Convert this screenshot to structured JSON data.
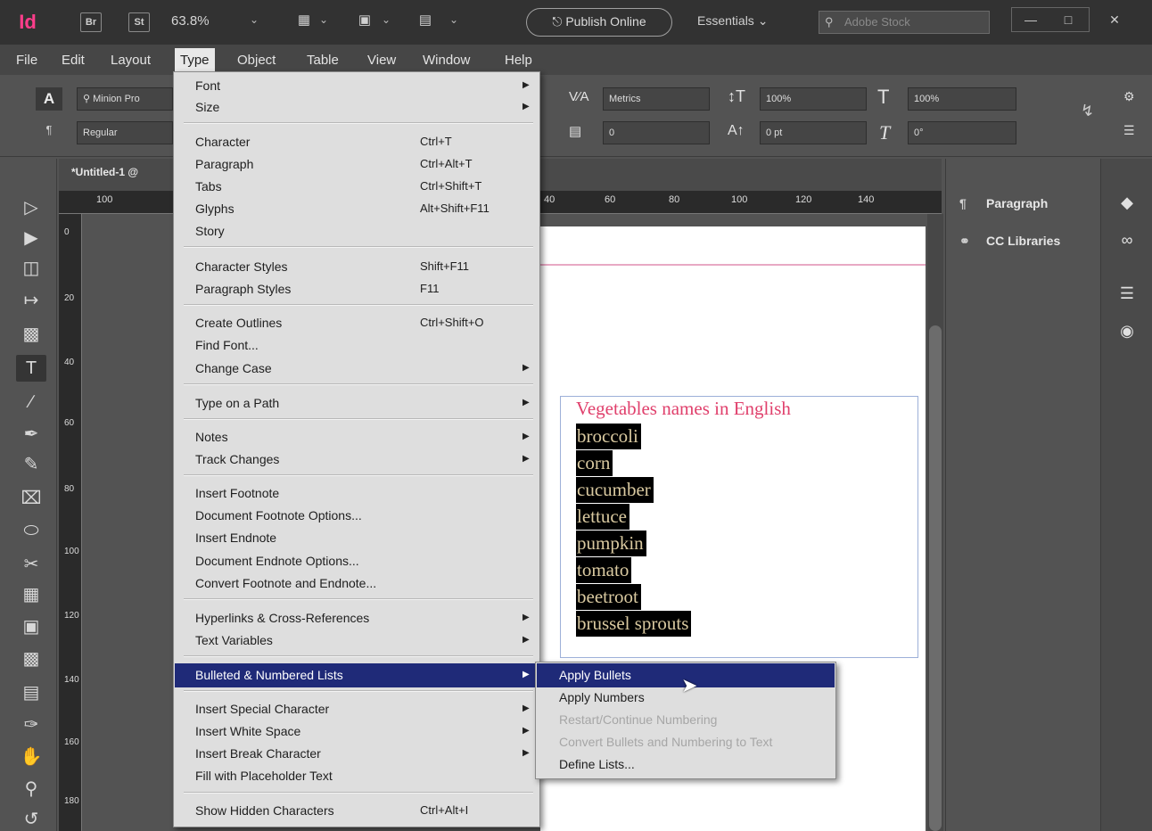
{
  "colors": {
    "brand": "#ff3d8b",
    "menu_highlight": "#1f2a78",
    "heading_text": "#e0406c",
    "highlighted_text_fg": "#d9c9a0"
  },
  "titlebar": {
    "app_logo": "Id",
    "bridge_btn": "Br",
    "stock_btn": "St",
    "zoom": "63.8%",
    "publish_online": "Publish Online",
    "workspace": "Essentials",
    "search_placeholder": "Adobe Stock"
  },
  "menubar": [
    "File",
    "Edit",
    "Layout",
    "Type",
    "Object",
    "Table",
    "View",
    "Window",
    "Help"
  ],
  "control_panel": {
    "font_family": "Minion Pro",
    "font_style": "Regular",
    "kerning": "Metrics",
    "tracking": "0",
    "vertical_scale": "100%",
    "horizontal_scale": "100%",
    "baseline_shift": "0 pt",
    "skew": "0°"
  },
  "document_tab": "*Untitled-1 @",
  "ruler": {
    "top_labels": [
      "100",
      "40",
      "60",
      "80",
      "100",
      "120",
      "140"
    ],
    "left_labels": [
      "0",
      "20",
      "40",
      "60",
      "80",
      "100",
      "120",
      "140",
      "160",
      "180"
    ]
  },
  "type_menu": {
    "items": [
      {
        "label": "Font",
        "submenu": true
      },
      {
        "label": "Size",
        "submenu": true
      },
      {
        "label": "Character",
        "shortcut": "Ctrl+T"
      },
      {
        "label": "Paragraph",
        "shortcut": "Ctrl+Alt+T"
      },
      {
        "label": "Tabs",
        "shortcut": "Ctrl+Shift+T"
      },
      {
        "label": "Glyphs",
        "shortcut": "Alt+Shift+F11"
      },
      {
        "label": "Story"
      },
      {
        "label": "Character Styles",
        "shortcut": "Shift+F11"
      },
      {
        "label": "Paragraph Styles",
        "shortcut": "F11"
      },
      {
        "label": "Create Outlines",
        "shortcut": "Ctrl+Shift+O"
      },
      {
        "label": "Find Font..."
      },
      {
        "label": "Change Case",
        "submenu": true
      },
      {
        "label": "Type on a Path",
        "submenu": true
      },
      {
        "label": "Notes",
        "submenu": true
      },
      {
        "label": "Track Changes",
        "submenu": true
      },
      {
        "label": "Insert Footnote"
      },
      {
        "label": "Document Footnote Options..."
      },
      {
        "label": "Insert Endnote"
      },
      {
        "label": "Document Endnote Options..."
      },
      {
        "label": "Convert Footnote and Endnote..."
      },
      {
        "label": "Hyperlinks & Cross-References",
        "submenu": true
      },
      {
        "label": "Text Variables",
        "submenu": true
      },
      {
        "label": "Bulleted & Numbered Lists",
        "submenu": true,
        "highlighted": true
      },
      {
        "label": "Insert Special Character",
        "submenu": true
      },
      {
        "label": "Insert White Space",
        "submenu": true
      },
      {
        "label": "Insert Break Character",
        "submenu": true
      },
      {
        "label": "Fill with Placeholder Text"
      },
      {
        "label": "Show Hidden Characters",
        "shortcut": "Ctrl+Alt+I"
      }
    ]
  },
  "lists_submenu": {
    "items": [
      {
        "label": "Apply Bullets",
        "highlighted": true
      },
      {
        "label": "Apply Numbers"
      },
      {
        "label": "Restart/Continue Numbering",
        "disabled": true
      },
      {
        "label": "Convert Bullets and Numbering to Text",
        "disabled": true
      },
      {
        "label": "Define Lists..."
      }
    ]
  },
  "document": {
    "heading": "Vegetables names in English",
    "items": [
      "broccoli",
      "corn",
      "cucumber",
      "lettuce",
      "pumpkin",
      "tomato",
      "beetroot",
      "brussel sprouts"
    ]
  },
  "right_panel": {
    "entries": [
      "Paragraph",
      "CC Libraries"
    ]
  }
}
